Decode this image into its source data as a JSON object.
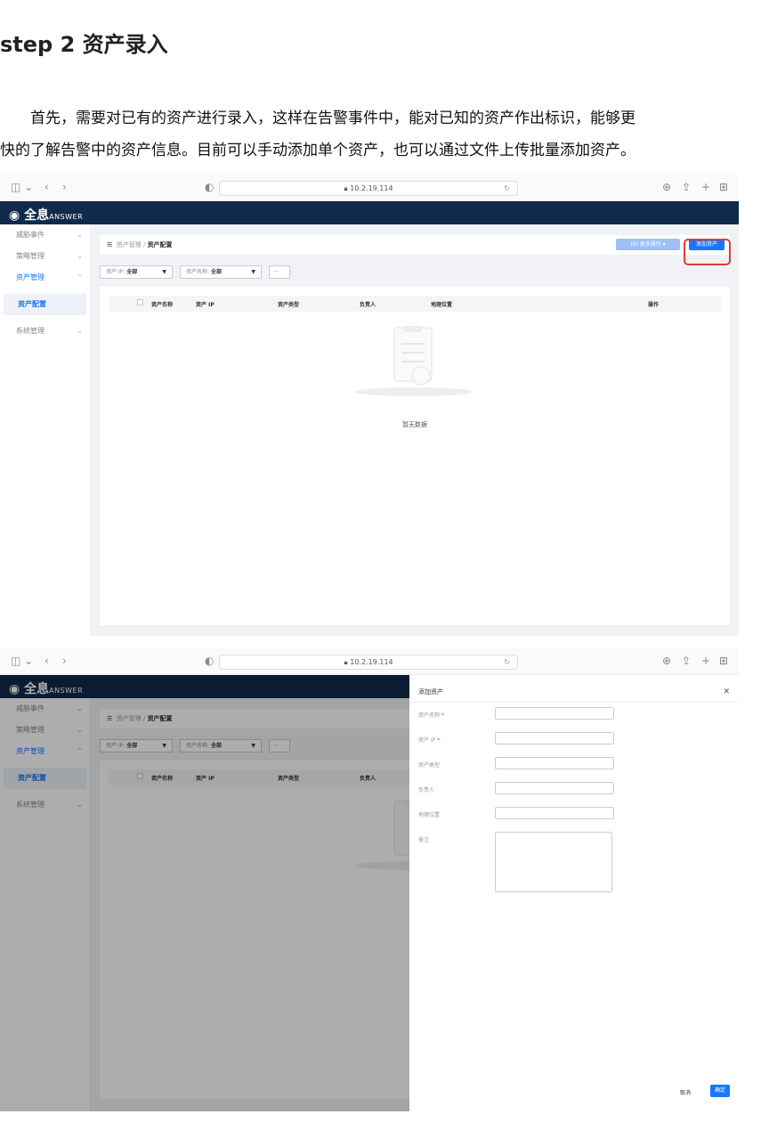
{
  "heading": "step 2  资产录入",
  "paragraph": {
    "line1": "首先，需要对已有的资产进行录入，这样在告警事件中，能对已知的资产作出标识，能够更",
    "line2": "快的了解告警中的资产信息。目前可以手动添加单个资产，也可以通过文件上传批量添加资产。"
  },
  "browser": {
    "url": "10.2.19.114"
  },
  "app": {
    "logo_cn": "全息",
    "logo_en": "ANSWER"
  },
  "sidebar": {
    "items": [
      {
        "label": "威胁事件"
      },
      {
        "label": "策略管理"
      },
      {
        "label": "资产管理"
      },
      {
        "label": "资产配置"
      },
      {
        "label": "系统管理"
      }
    ]
  },
  "breadcrumb": {
    "parent": "资产管理",
    "sep": "/",
    "current": "资产配置"
  },
  "toolbar": {
    "more_label": "(0) 更多操作",
    "add_label": "添加资产"
  },
  "filters": {
    "ip_label": "资产 IP:",
    "ip_value": "全部",
    "name_label": "资产名称:",
    "name_value": "全部",
    "more": "···"
  },
  "table": {
    "columns": [
      "资产名称",
      "资产 IP",
      "资产类型",
      "负责人",
      "地理位置",
      "操作"
    ],
    "empty_text": "暂无数据"
  },
  "drawer": {
    "title": "添加资产",
    "fields": [
      {
        "label": "资产名称",
        "required": "*"
      },
      {
        "label": "资产 IP",
        "required": "*"
      },
      {
        "label": "资产类型",
        "required": ""
      },
      {
        "label": "负责人",
        "required": ""
      },
      {
        "label": "地理位置",
        "required": ""
      },
      {
        "label": "备注",
        "required": ""
      }
    ],
    "cancel": "取消",
    "ok": "确定"
  },
  "icons": [
    "sidebar-toggle-icon",
    "back-icon",
    "forward-icon",
    "shield-icon",
    "lock-icon",
    "reload-icon",
    "download-icon",
    "share-icon",
    "new-tab-icon",
    "grid-icon",
    "menu-icon",
    "chevron-down-icon",
    "close-icon"
  ]
}
